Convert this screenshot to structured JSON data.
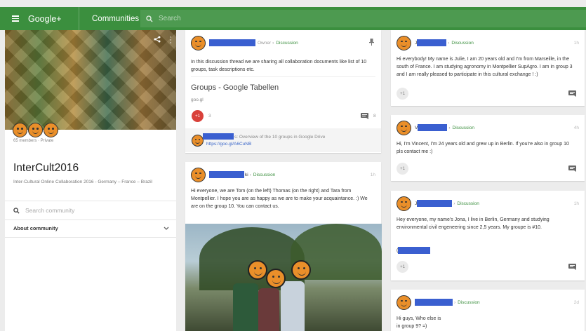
{
  "topbar": {
    "brand": "Google+",
    "section": "Communities",
    "search_placeholder": "Search",
    "color": "#3b8f3e"
  },
  "sidebar": {
    "member_count": "65 members · Private",
    "title": "InterCult2016",
    "description": "Inter-Cultural Online Collaboration 2016 - Germany – France – Brazil",
    "search_placeholder": "Search community",
    "about_label": "About community"
  },
  "posts": [
    {
      "role": "Owner",
      "category": "Discussion",
      "text": "In this discussion thread we are sharing all collaboration documents like list of 10 groups, task descriptions etc.",
      "link_title": "Groups - Google Tabellen",
      "link_domain": "goo.gl",
      "plus_label": "+1",
      "plus_count": "3",
      "comment_count": "8",
      "comment_text": "s: Overview of the 10 groups in Google Drive",
      "comment_link": "https://goo.gl/A6CuNB"
    },
    {
      "name_suffix": "ki",
      "category": "Discussion",
      "time": "1h",
      "text": "Hi everyone, we are Tom (on the left) Thomas (on the right) and Tara from Montpellier. I hope you are as happy as we are to make your acquaintance. :) We are on the group 10. You can contact us."
    },
    {
      "name_prefix": "J",
      "category": "Discussion",
      "time": "1h",
      "text": "Hi everybody! My name is Julie, I am 20 years old and I'm from Marseille, in the south of France. I am studying agronomy in Montpellier SupAgro. I am in group 3 and I am really pleased to participate in this cultural exchange ! :)",
      "plus_label": "+1"
    },
    {
      "name_prefix": "V",
      "category": "Discussion",
      "time": "4h",
      "text": "Hi, I'm Vincent, I'm 24 years old and grew up in Berlin. If you're also in group 10 pls contact me :)",
      "plus_label": "+1"
    },
    {
      "name_prefix": "J",
      "category": "Discussion",
      "time": "1h",
      "text": "Hey everyone, my name's Jona, I live in Berlin, Germany and studying environmental civil engeneering since 2,5 years. My groupe is #10.",
      "signature_prefix": "(",
      "plus_label": "+1"
    },
    {
      "category": "Discussion",
      "time": "2d",
      "text": "Hi guys, Who else is in group 9? =)"
    }
  ],
  "colors": {
    "accent_green": "#3b8f3e",
    "redaction_blue": "#3a5fd0",
    "avatar_orange": "#ea8f2a",
    "plus_red": "#d9413a"
  }
}
